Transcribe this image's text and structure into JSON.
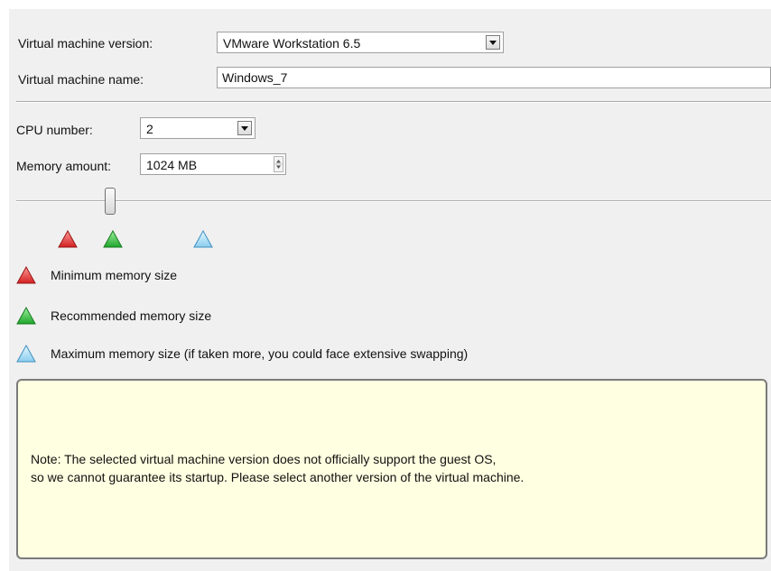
{
  "vm_version": {
    "label": "Virtual machine version:",
    "value": "VMware Workstation 6.5"
  },
  "vm_name": {
    "label": "Virtual machine name:",
    "value": "Windows_7"
  },
  "cpu": {
    "label": "CPU number:",
    "value": "2"
  },
  "memory": {
    "label": "Memory amount:",
    "value": "1024 MB"
  },
  "legend": {
    "min": {
      "label": "Minimum memory size",
      "color": "#e23434",
      "icon": "triangle-red-icon"
    },
    "recommended": {
      "label": "Recommended memory size",
      "color": "#2fbb3a",
      "icon": "triangle-green-icon"
    },
    "max": {
      "label": "Maximum memory size (if taken more, you could face extensive swapping)",
      "color": "#8fd3f2",
      "icon": "triangle-blue-icon"
    }
  },
  "note": {
    "line1": "Note: The selected virtual machine version does not officially support the guest OS,",
    "line2": "so we cannot guarantee its startup. Please select another version of the virtual machine."
  }
}
